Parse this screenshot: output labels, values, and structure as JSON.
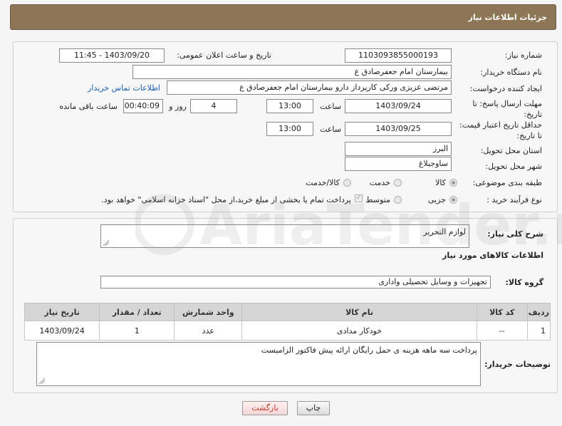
{
  "header": {
    "title": "جزئیات اطلاعات نیاز"
  },
  "form": {
    "need_number_label": "شماره نیاز:",
    "need_number": "1103093855000193",
    "announce_datetime_label": "تاریخ و ساعت اعلان عمومی:",
    "announce_datetime": "1403/09/20 - 11:45",
    "buyer_org_label": "نام دستگاه خریدار:",
    "buyer_org": "بیمارستان امام جعفرصادق ع",
    "requester_label": "ایجاد کننده درخواست:",
    "requester": "مرتضی عزیزی ورکی کارپرداز دارو بیمارستان امام جعفرصادق ع",
    "buyer_contact_link": "اطلاعات تماس خریدار",
    "reply_deadline_label": "مهلت ارسال پاسخ: تا تاریخ:",
    "reply_date": "1403/09/24",
    "time_label": "ساعت",
    "reply_time": "13:00",
    "days_value": "4",
    "days_label": "روز و",
    "remaining_time": "00:40:09",
    "remaining_label": "ساعت باقی مانده",
    "price_validity_label": "حداقل تاریخ اعتبار قیمت: تا تاریخ:",
    "price_date": "1403/09/25",
    "price_time": "13:00",
    "province_label": "استان محل تحویل:",
    "province": "البرز",
    "city_label": "شهر محل تحویل:",
    "city": "ساوجبلاغ",
    "category_label": "طبقه بندی موضوعی:",
    "category_options": [
      "کالا",
      "خدمت",
      "کالا/خدمت"
    ],
    "purchase_type_label": "نوع فرآیند خرید :",
    "purchase_options": [
      "جزیی",
      "متوسط"
    ],
    "payment_note": "پرداخت تمام یا بخشی از مبلغ خرید،از محل \"اسناد خزانه اسلامی\" خواهد بود."
  },
  "details": {
    "summary_label": "شرح کلی نیاز:",
    "summary_value": "لوازم التحریر",
    "goods_info_title": "اطلاعات کالاهای مورد نیاز",
    "goods_group_label": "گروه کالا:",
    "goods_group_value": "تجهیزات و وسایل تحصیلی واداری",
    "table": {
      "headers": [
        "ردیف",
        "کد کالا",
        "نام کالا",
        "واحد شمارش",
        "تعداد / مقدار",
        "تاریخ نیاز"
      ],
      "rows": [
        [
          "1",
          "--",
          "خودکار مدادی",
          "عدد",
          "1",
          "1403/09/24"
        ]
      ]
    },
    "buyer_notes_label": "توضیحات خریدار:",
    "buyer_notes_value": "پرداخت سه ماهه هزینه ی حمل رایگان ارائه پیش فاکتور الزامیست"
  },
  "buttons": {
    "print": "چاپ",
    "back": "بازگشت"
  },
  "watermark": {
    "text": "AriaTender.net"
  },
  "colors": {
    "header_bg": "#8d7656",
    "link": "#1a5fb4",
    "back_btn_text": "#c0392b"
  }
}
